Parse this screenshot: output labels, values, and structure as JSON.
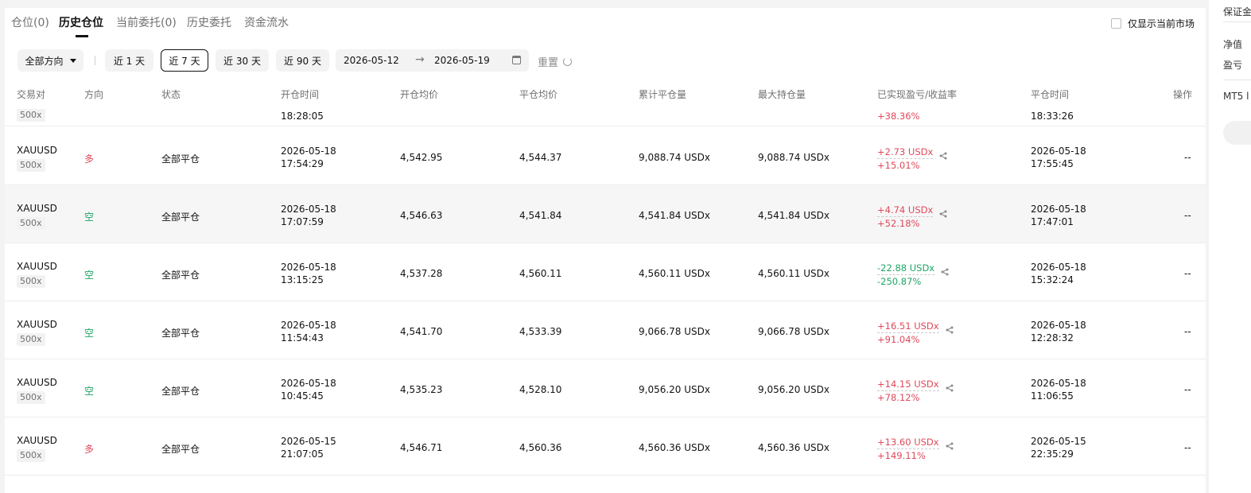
{
  "tabs": [
    {
      "label": "仓位(0)"
    },
    {
      "label": "历史仓位"
    },
    {
      "label": "当前委托(0)"
    },
    {
      "label": "历史委托"
    },
    {
      "label": "资金流水"
    }
  ],
  "market_filter": {
    "label": "仅显示当前市场"
  },
  "filters": {
    "direction": "全部方向",
    "ranges": [
      "近 1 天",
      "近 7 天",
      "近 30 天",
      "近 90 天"
    ],
    "active_range": "近 7 天",
    "date_start": "2026-05-12",
    "date_end": "2026-05-19",
    "reset": "重置"
  },
  "right_panel": {
    "items": [
      "保证金",
      "净值",
      "盈亏",
      "MT5 l"
    ]
  },
  "columns": [
    "交易对",
    "方向",
    "状态",
    "开仓时间",
    "开仓均价",
    "平仓均价",
    "累计平仓量",
    "最大持仓量",
    "已实现盈亏/收益率",
    "平仓时间",
    "操作"
  ],
  "partial_row": {
    "leverage": "500x",
    "open_time": "18:28:05",
    "pnl_rate": "+38.36%",
    "close_time": "18:33:26"
  },
  "rows": [
    {
      "pair": "XAUUSD",
      "leverage": "500x",
      "direction": "多",
      "side": "long",
      "status": "全部平仓",
      "open_date": "2026-05-18",
      "open_time": "17:54:29",
      "open_price": "4,542.95",
      "close_price": "4,544.37",
      "closed_qty": "9,088.74 USDx",
      "max_qty": "9,088.74 USDx",
      "pnl": "+2.73 USDx",
      "pnl_rate": "+15.01%",
      "pnl_sign": "pos",
      "close_date": "2026-05-18",
      "close_time": "17:55:45",
      "action": "--"
    },
    {
      "pair": "XAUUSD",
      "leverage": "500x",
      "direction": "空",
      "side": "short",
      "status": "全部平仓",
      "open_date": "2026-05-18",
      "open_time": "17:07:59",
      "open_price": "4,546.63",
      "close_price": "4,541.84",
      "closed_qty": "4,541.84 USDx",
      "max_qty": "4,541.84 USDx",
      "pnl": "+4.74 USDx",
      "pnl_rate": "+52.18%",
      "pnl_sign": "pos",
      "close_date": "2026-05-18",
      "close_time": "17:47:01",
      "action": "--"
    },
    {
      "pair": "XAUUSD",
      "leverage": "500x",
      "direction": "空",
      "side": "short",
      "status": "全部平仓",
      "open_date": "2026-05-18",
      "open_time": "13:15:25",
      "open_price": "4,537.28",
      "close_price": "4,560.11",
      "closed_qty": "4,560.11 USDx",
      "max_qty": "4,560.11 USDx",
      "pnl": "-22.88 USDx",
      "pnl_rate": "-250.87%",
      "pnl_sign": "neg",
      "close_date": "2026-05-18",
      "close_time": "15:32:24",
      "action": "--"
    },
    {
      "pair": "XAUUSD",
      "leverage": "500x",
      "direction": "空",
      "side": "short",
      "status": "全部平仓",
      "open_date": "2026-05-18",
      "open_time": "11:54:43",
      "open_price": "4,541.70",
      "close_price": "4,533.39",
      "closed_qty": "9,066.78 USDx",
      "max_qty": "9,066.78 USDx",
      "pnl": "+16.51 USDx",
      "pnl_rate": "+91.04%",
      "pnl_sign": "pos",
      "close_date": "2026-05-18",
      "close_time": "12:28:32",
      "action": "--"
    },
    {
      "pair": "XAUUSD",
      "leverage": "500x",
      "direction": "空",
      "side": "short",
      "status": "全部平仓",
      "open_date": "2026-05-18",
      "open_time": "10:45:45",
      "open_price": "4,535.23",
      "close_price": "4,528.10",
      "closed_qty": "9,056.20 USDx",
      "max_qty": "9,056.20 USDx",
      "pnl": "+14.15 USDx",
      "pnl_rate": "+78.12%",
      "pnl_sign": "pos",
      "close_date": "2026-05-18",
      "close_time": "11:06:55",
      "action": "--"
    },
    {
      "pair": "XAUUSD",
      "leverage": "500x",
      "direction": "多",
      "side": "long",
      "status": "全部平仓",
      "open_date": "2026-05-15",
      "open_time": "21:07:05",
      "open_price": "4,546.71",
      "close_price": "4,560.36",
      "closed_qty": "4,560.36 USDx",
      "max_qty": "4,560.36 USDx",
      "pnl": "+13.60 USDx",
      "pnl_rate": "+149.11%",
      "pnl_sign": "pos",
      "close_date": "2026-05-15",
      "close_time": "22:35:29",
      "action": "--"
    }
  ],
  "colors": {
    "positive": "#e0495b",
    "negative": "#1fa566"
  }
}
